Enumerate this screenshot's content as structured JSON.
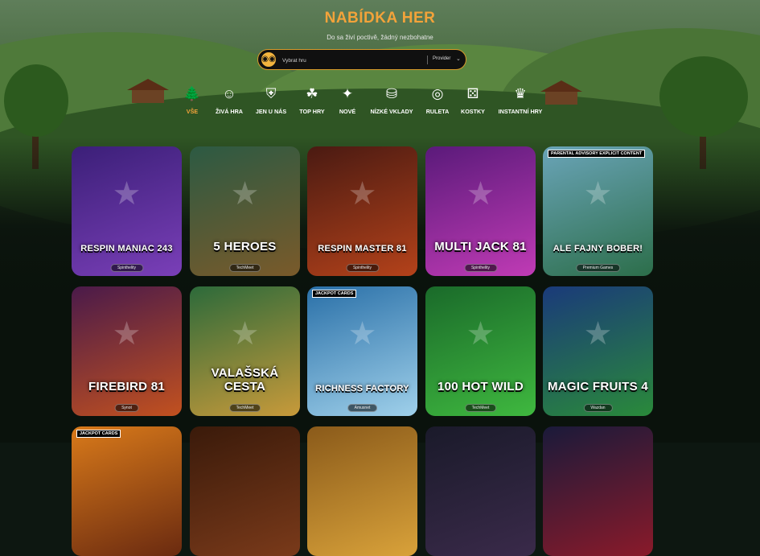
{
  "page": {
    "title": "NABÍDKA HER",
    "subtitle": "Do sa živí poctivě, žádný nezbohatne"
  },
  "search": {
    "placeholder": "Vybrat hru",
    "provider_label": "Provider",
    "icon": "binoculars-icon"
  },
  "categories": [
    {
      "label": "VŠE",
      "icon": "tree-icon",
      "active": true
    },
    {
      "label": "ŽIVÁ HRA",
      "icon": "dealer-icon"
    },
    {
      "label": "JEN U NÁS",
      "icon": "shield-icon"
    },
    {
      "label": "TOP HRY",
      "icon": "fruit-icon"
    },
    {
      "label": "NOVÉ",
      "icon": "tag-icon"
    },
    {
      "label": "NÍZKÉ VKLADY",
      "icon": "coins-icon"
    },
    {
      "label": "RULETA",
      "icon": "roulette-icon"
    },
    {
      "label": "KOSTKY",
      "icon": "dice-icon"
    },
    {
      "label": "INSTANTNÍ HRY",
      "icon": "crown-icon"
    }
  ],
  "games": [
    {
      "title": "RESPIN MANIAC 243",
      "provider": "Spinthelity",
      "colors": [
        "#3b1f78",
        "#7a3fb8"
      ],
      "icon": "joker-face-icon"
    },
    {
      "title": "5 HEROES",
      "provider": "TechMeet",
      "colors": [
        "#2c5a43",
        "#7a5a2a"
      ],
      "icon": "genie-icon"
    },
    {
      "title": "RESPIN MASTER 81",
      "provider": "Spinthelity",
      "colors": [
        "#4a1a12",
        "#b4421a"
      ],
      "icon": "wizard-icon"
    },
    {
      "title": "MULTI JACK 81",
      "provider": "Spinthelity",
      "colors": [
        "#5a1a7a",
        "#c03bb5"
      ],
      "icon": "jester-icon"
    },
    {
      "title": "ALE FAJNY BOBER!",
      "provider": "Premium Games",
      "colors": [
        "#6aa4b8",
        "#2c6e4a"
      ],
      "icon": "beaver-icon",
      "badge": "PARENTAL ADVISORY EXPLICIT CONTENT"
    },
    {
      "title": "FIREBIRD 81",
      "provider": "Synot",
      "colors": [
        "#4a1a4a",
        "#c2511f"
      ],
      "icon": "phoenix-icon"
    },
    {
      "title": "VALAŠSKÁ CESTA",
      "provider": "TechMeet",
      "colors": [
        "#2c6a3a",
        "#c89a3a"
      ],
      "icon": "maiden-icon"
    },
    {
      "title": "RICHNESS FACTORY",
      "provider": "Amusnet",
      "colors": [
        "#2a70a8",
        "#9fd0ea"
      ],
      "icon": "elf-icon",
      "badge": "JACKPOT CARDS"
    },
    {
      "title": "100 HOT WILD",
      "provider": "TechMeet",
      "colors": [
        "#1a6a2a",
        "#3fb83f"
      ],
      "icon": "jester-icon"
    },
    {
      "title": "MAGIC FRUITS 4",
      "provider": "Wazdan",
      "colors": [
        "#1a3a7a",
        "#2a8a3a"
      ],
      "icon": "goblin-icon"
    },
    {
      "title": "",
      "provider": "",
      "colors": [
        "#d97a1a",
        "#6a2a10"
      ],
      "icon": "",
      "badge": "JACKPOT CARDS"
    },
    {
      "title": "",
      "provider": "",
      "colors": [
        "#3a1a0a",
        "#7a3a1a"
      ],
      "icon": ""
    },
    {
      "title": "",
      "provider": "",
      "colors": [
        "#8a5a1a",
        "#d9a23a"
      ],
      "icon": ""
    },
    {
      "title": "",
      "provider": "",
      "colors": [
        "#1a1a2a",
        "#3a2a4a"
      ],
      "icon": ""
    },
    {
      "title": "",
      "provider": "",
      "colors": [
        "#1a1a3a",
        "#8a1a2a"
      ],
      "icon": ""
    }
  ]
}
